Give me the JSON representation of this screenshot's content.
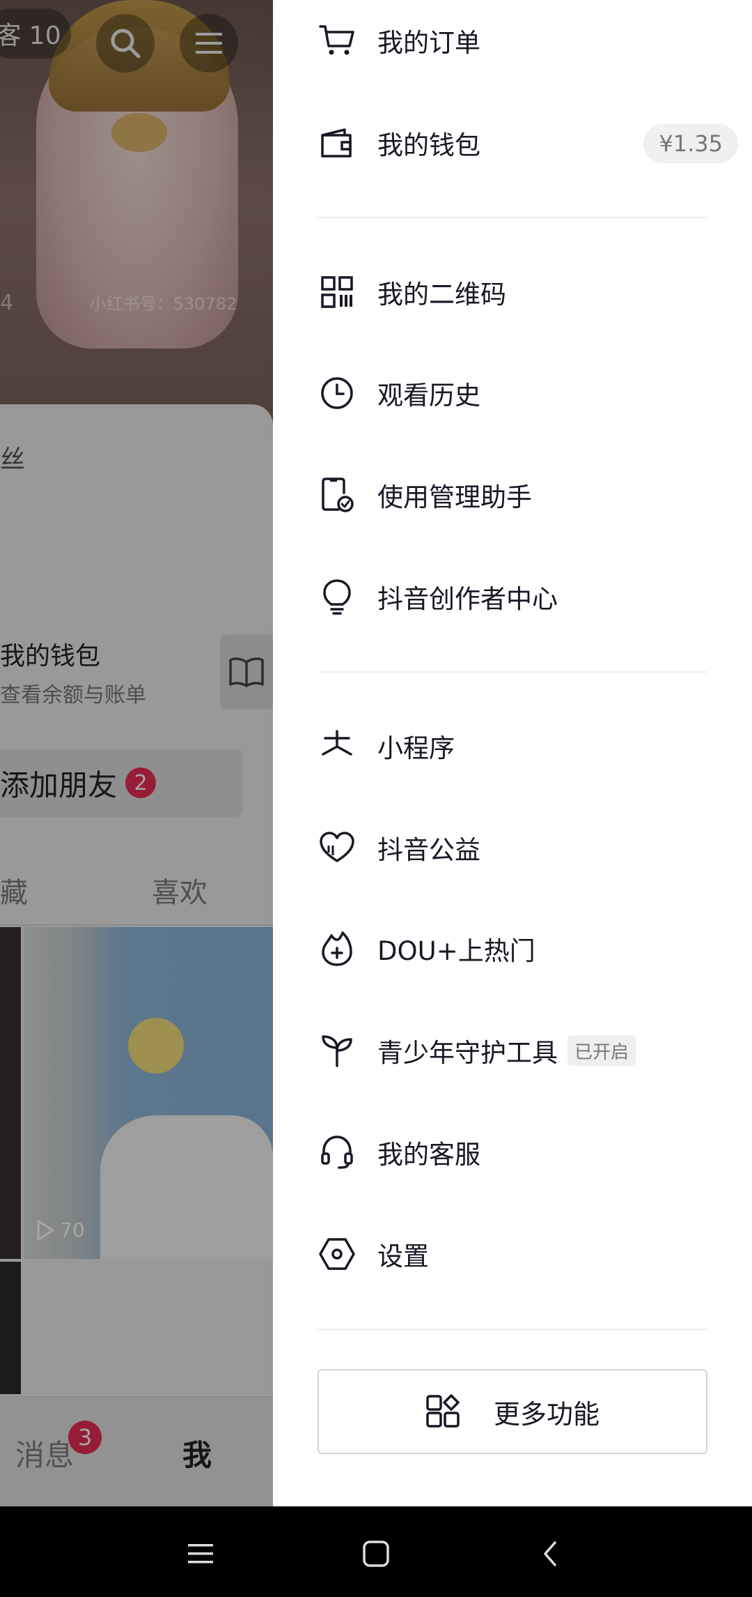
{
  "background": {
    "visitor_pill": "客 10",
    "id_row": "4",
    "id_text": "小红书号：530782",
    "fans_text": "丝",
    "wallet_title": "我的钱包",
    "wallet_sub": "查看余额与账单",
    "add_friend": "添加朋友",
    "add_friend_badge": "2",
    "tab_collect": "藏",
    "tab_like": "喜欢",
    "play_count": "70",
    "nav_msg": "消息",
    "nav_msg_badge": "3",
    "nav_me": "我"
  },
  "drawer": {
    "orders": "我的订单",
    "wallet": "我的钱包",
    "wallet_balance": "¥1.35",
    "qrcode": "我的二维码",
    "history": "观看历史",
    "usage_assistant": "使用管理助手",
    "creator_center": "抖音创作者中心",
    "mini_programs": "小程序",
    "charity": "抖音公益",
    "dou_plus": "DOU+上热门",
    "youth_tool": "青少年守护工具",
    "youth_tag": "已开启",
    "customer_service": "我的客服",
    "settings": "设置",
    "more_features": "更多功能"
  },
  "colors": {
    "accent_red": "#e92c52",
    "text": "#161823",
    "divider": "#ededed"
  }
}
